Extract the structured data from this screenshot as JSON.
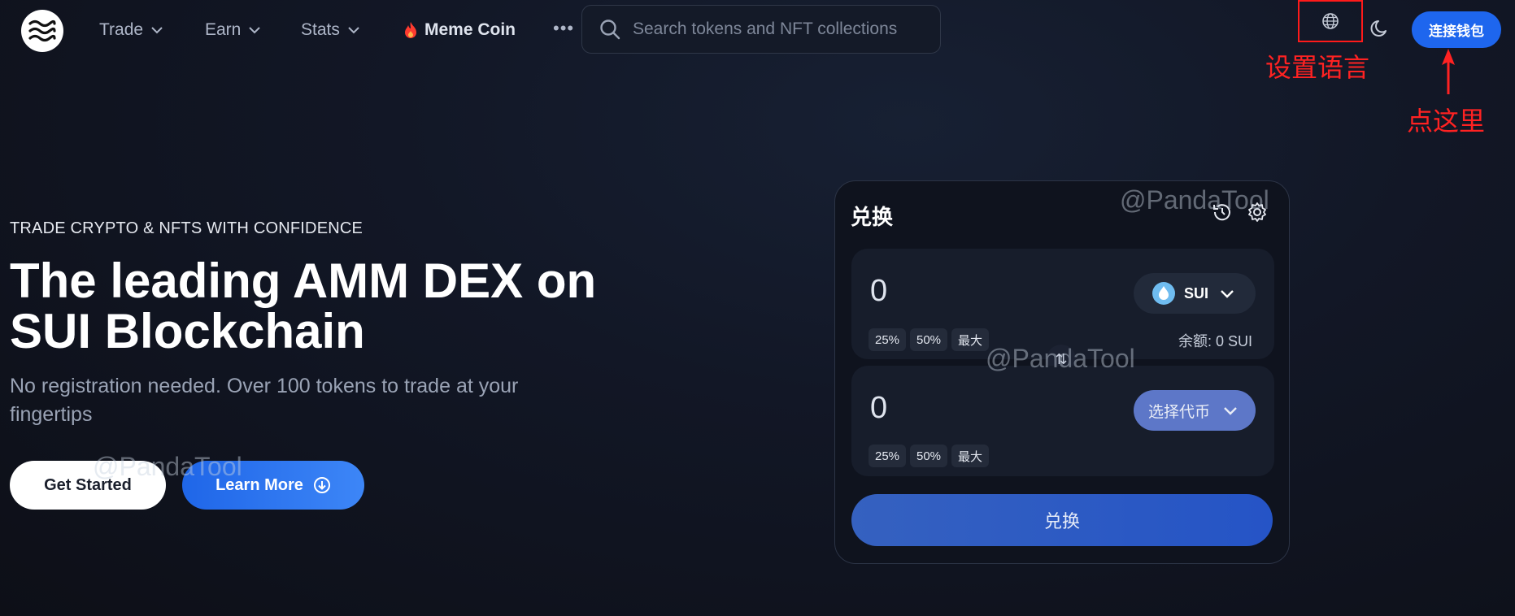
{
  "header": {
    "nav": [
      {
        "label": "Trade"
      },
      {
        "label": "Earn"
      },
      {
        "label": "Stats"
      }
    ],
    "meme_label": "Meme Coin",
    "more_icon": "ellipsis-icon",
    "search_placeholder": "Search tokens and NFT collections",
    "connect_label": "连接钱包"
  },
  "annotations": {
    "language_note": "设置语言",
    "click_note": "点这里"
  },
  "hero": {
    "tagline": "TRADE CRYPTO & NFTS WITH CONFIDENCE",
    "heading_line1": "The leading AMM DEX on",
    "heading_line2": "SUI Blockchain",
    "subtitle": "No registration needed. Over 100 tokens to trade at your fingertips",
    "get_started": "Get Started",
    "learn_more": "Learn More"
  },
  "watermark": "@PandaTool",
  "swap": {
    "title": "兑换",
    "from_amount": "0",
    "from_token": "SUI",
    "percent_buttons": [
      "25%",
      "50%",
      "最大"
    ],
    "balance": "余额: 0 SUI",
    "to_amount": "0",
    "to_token_placeholder": "选择代币",
    "submit_label": "兑换"
  },
  "colors": {
    "accent": "#1e66ee",
    "annotation": "#ff2222"
  }
}
